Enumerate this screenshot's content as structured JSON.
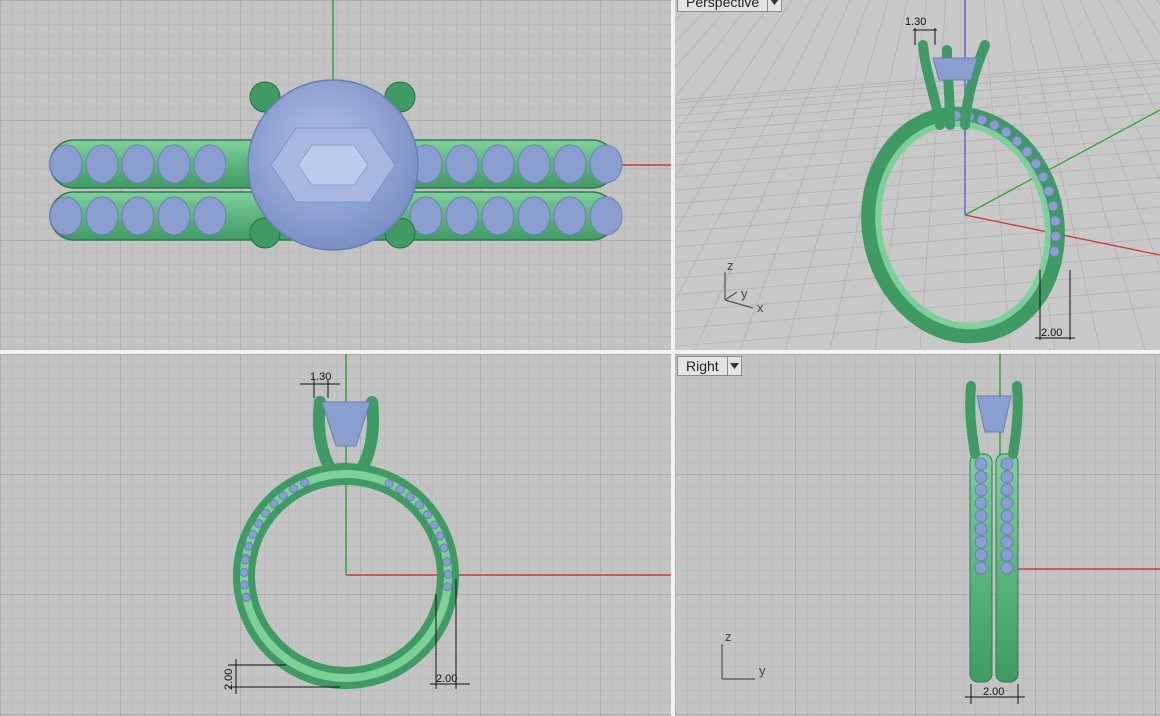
{
  "viewports": {
    "top": {
      "name": ""
    },
    "perspective": {
      "name": "Perspective"
    },
    "front": {
      "name": ""
    },
    "right": {
      "name": "Right"
    }
  },
  "dimensions": {
    "prong_width": "1.30",
    "band_width": "2.00",
    "band_thickness": "2.00"
  },
  "axis_labels": {
    "x": "x",
    "y": "y",
    "z": "z"
  },
  "colors": {
    "viewport_bg": "#c3c3c3",
    "grid_minor": "#b3b3b3",
    "grid_major": "#a1a1a1",
    "x_axis": "#c83a3a",
    "y_axis": "#3aa23a",
    "z_axis": "#5555d0",
    "metal": "#5cb87f",
    "metal_dark": "#2f7d50",
    "gem": "#8a9fd0",
    "gem_light": "#b2c1e6"
  },
  "icons": {
    "viewport_menu": "chevron-down-icon"
  }
}
